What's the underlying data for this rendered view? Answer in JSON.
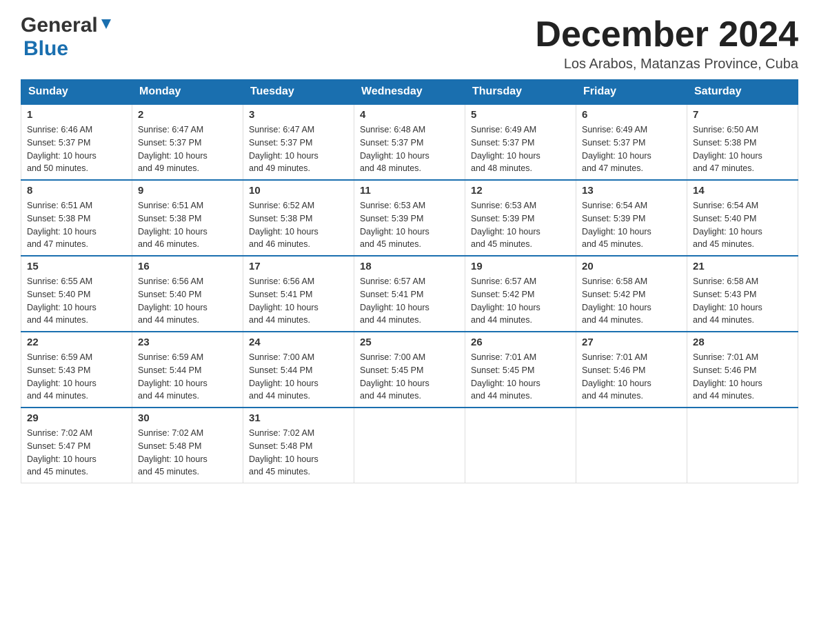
{
  "header": {
    "logo_general": "General",
    "logo_blue": "Blue",
    "title": "December 2024",
    "subtitle": "Los Arabos, Matanzas Province, Cuba"
  },
  "days_of_week": [
    "Sunday",
    "Monday",
    "Tuesday",
    "Wednesday",
    "Thursday",
    "Friday",
    "Saturday"
  ],
  "weeks": [
    [
      {
        "day": "1",
        "sunrise": "6:46 AM",
        "sunset": "5:37 PM",
        "daylight": "10 hours and 50 minutes."
      },
      {
        "day": "2",
        "sunrise": "6:47 AM",
        "sunset": "5:37 PM",
        "daylight": "10 hours and 49 minutes."
      },
      {
        "day": "3",
        "sunrise": "6:47 AM",
        "sunset": "5:37 PM",
        "daylight": "10 hours and 49 minutes."
      },
      {
        "day": "4",
        "sunrise": "6:48 AM",
        "sunset": "5:37 PM",
        "daylight": "10 hours and 48 minutes."
      },
      {
        "day": "5",
        "sunrise": "6:49 AM",
        "sunset": "5:37 PM",
        "daylight": "10 hours and 48 minutes."
      },
      {
        "day": "6",
        "sunrise": "6:49 AM",
        "sunset": "5:37 PM",
        "daylight": "10 hours and 47 minutes."
      },
      {
        "day": "7",
        "sunrise": "6:50 AM",
        "sunset": "5:38 PM",
        "daylight": "10 hours and 47 minutes."
      }
    ],
    [
      {
        "day": "8",
        "sunrise": "6:51 AM",
        "sunset": "5:38 PM",
        "daylight": "10 hours and 47 minutes."
      },
      {
        "day": "9",
        "sunrise": "6:51 AM",
        "sunset": "5:38 PM",
        "daylight": "10 hours and 46 minutes."
      },
      {
        "day": "10",
        "sunrise": "6:52 AM",
        "sunset": "5:38 PM",
        "daylight": "10 hours and 46 minutes."
      },
      {
        "day": "11",
        "sunrise": "6:53 AM",
        "sunset": "5:39 PM",
        "daylight": "10 hours and 45 minutes."
      },
      {
        "day": "12",
        "sunrise": "6:53 AM",
        "sunset": "5:39 PM",
        "daylight": "10 hours and 45 minutes."
      },
      {
        "day": "13",
        "sunrise": "6:54 AM",
        "sunset": "5:39 PM",
        "daylight": "10 hours and 45 minutes."
      },
      {
        "day": "14",
        "sunrise": "6:54 AM",
        "sunset": "5:40 PM",
        "daylight": "10 hours and 45 minutes."
      }
    ],
    [
      {
        "day": "15",
        "sunrise": "6:55 AM",
        "sunset": "5:40 PM",
        "daylight": "10 hours and 44 minutes."
      },
      {
        "day": "16",
        "sunrise": "6:56 AM",
        "sunset": "5:40 PM",
        "daylight": "10 hours and 44 minutes."
      },
      {
        "day": "17",
        "sunrise": "6:56 AM",
        "sunset": "5:41 PM",
        "daylight": "10 hours and 44 minutes."
      },
      {
        "day": "18",
        "sunrise": "6:57 AM",
        "sunset": "5:41 PM",
        "daylight": "10 hours and 44 minutes."
      },
      {
        "day": "19",
        "sunrise": "6:57 AM",
        "sunset": "5:42 PM",
        "daylight": "10 hours and 44 minutes."
      },
      {
        "day": "20",
        "sunrise": "6:58 AM",
        "sunset": "5:42 PM",
        "daylight": "10 hours and 44 minutes."
      },
      {
        "day": "21",
        "sunrise": "6:58 AM",
        "sunset": "5:43 PM",
        "daylight": "10 hours and 44 minutes."
      }
    ],
    [
      {
        "day": "22",
        "sunrise": "6:59 AM",
        "sunset": "5:43 PM",
        "daylight": "10 hours and 44 minutes."
      },
      {
        "day": "23",
        "sunrise": "6:59 AM",
        "sunset": "5:44 PM",
        "daylight": "10 hours and 44 minutes."
      },
      {
        "day": "24",
        "sunrise": "7:00 AM",
        "sunset": "5:44 PM",
        "daylight": "10 hours and 44 minutes."
      },
      {
        "day": "25",
        "sunrise": "7:00 AM",
        "sunset": "5:45 PM",
        "daylight": "10 hours and 44 minutes."
      },
      {
        "day": "26",
        "sunrise": "7:01 AM",
        "sunset": "5:45 PM",
        "daylight": "10 hours and 44 minutes."
      },
      {
        "day": "27",
        "sunrise": "7:01 AM",
        "sunset": "5:46 PM",
        "daylight": "10 hours and 44 minutes."
      },
      {
        "day": "28",
        "sunrise": "7:01 AM",
        "sunset": "5:46 PM",
        "daylight": "10 hours and 44 minutes."
      }
    ],
    [
      {
        "day": "29",
        "sunrise": "7:02 AM",
        "sunset": "5:47 PM",
        "daylight": "10 hours and 45 minutes."
      },
      {
        "day": "30",
        "sunrise": "7:02 AM",
        "sunset": "5:48 PM",
        "daylight": "10 hours and 45 minutes."
      },
      {
        "day": "31",
        "sunrise": "7:02 AM",
        "sunset": "5:48 PM",
        "daylight": "10 hours and 45 minutes."
      },
      null,
      null,
      null,
      null
    ]
  ],
  "labels": {
    "sunrise": "Sunrise:",
    "sunset": "Sunset:",
    "daylight": "Daylight:"
  }
}
